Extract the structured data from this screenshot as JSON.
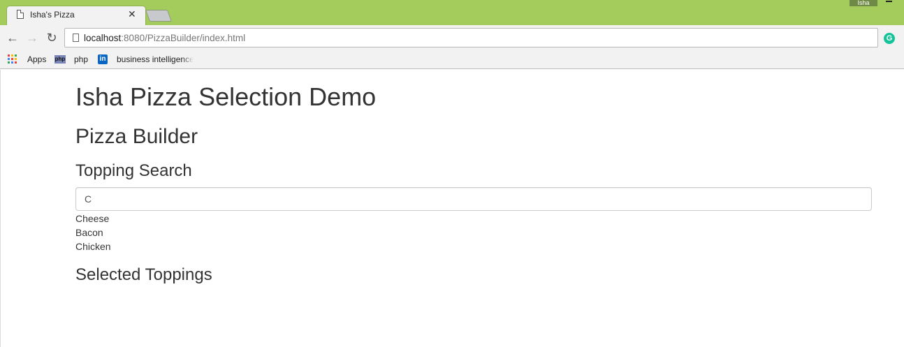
{
  "browser": {
    "tab": {
      "title": "Isha's Pizza",
      "close_glyph": "✕"
    },
    "profile_name": "Isha",
    "url_host": "localhost",
    "url_rest": ":8080/PizzaBuilder/index.html",
    "nav": {
      "back_glyph": "←",
      "forward_glyph": "→",
      "reload_glyph": "↻"
    },
    "extension_glyph": "G",
    "bookmarks": [
      {
        "label": "Apps",
        "icon": "apps-grid-icon"
      },
      {
        "label": "php",
        "icon": "php-icon",
        "icon_text": "php"
      },
      {
        "label": "business intelligence",
        "icon": "linkedin-icon",
        "icon_text": "in"
      }
    ],
    "apps_colors": [
      "#ea4335",
      "#fbbc05",
      "#34a853",
      "#4285f4",
      "#ea4335",
      "#fbbc05",
      "#34a853",
      "#4285f4",
      "#ea4335"
    ]
  },
  "page": {
    "title": "Isha Pizza Selection Demo",
    "builder_title": "Pizza Builder",
    "search_title": "Topping Search",
    "search_value": "C",
    "results": [
      "Cheese",
      "Bacon",
      "Chicken"
    ],
    "selected_title": "Selected Toppings"
  }
}
